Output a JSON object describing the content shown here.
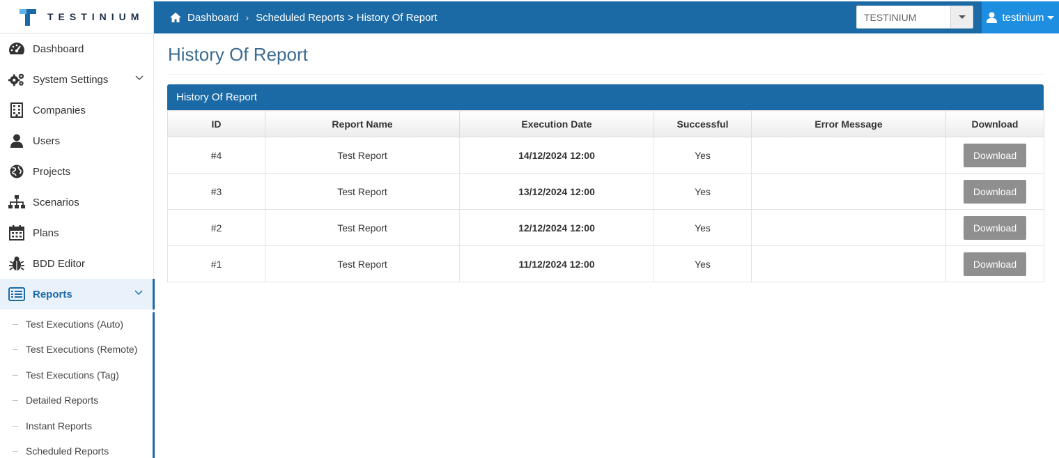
{
  "brand": {
    "name": "TESTINIUM"
  },
  "header": {
    "breadcrumb": {
      "home": "Dashboard",
      "path": "Scheduled Reports > History Of Report"
    },
    "company_select": {
      "value": "TESTINIUM"
    },
    "user": {
      "name": "testinium"
    }
  },
  "sidebar": {
    "items": [
      {
        "label": "Dashboard",
        "icon": "dashboard-gauge-icon"
      },
      {
        "label": "System Settings",
        "icon": "gears-icon"
      },
      {
        "label": "Companies",
        "icon": "building-icon"
      },
      {
        "label": "Users",
        "icon": "user-icon"
      },
      {
        "label": "Projects",
        "icon": "globe-icon"
      },
      {
        "label": "Scenarios",
        "icon": "sitemap-icon"
      },
      {
        "label": "Plans",
        "icon": "calendar-icon"
      },
      {
        "label": "BDD Editor",
        "icon": "bug-icon"
      },
      {
        "label": "Reports",
        "icon": "list-alt-icon"
      }
    ],
    "reports_submenu": [
      "Test Executions (Auto)",
      "Test Executions (Remote)",
      "Test Executions (Tag)",
      "Detailed Reports",
      "Instant Reports",
      "Scheduled Reports"
    ]
  },
  "main": {
    "title": "History Of Report",
    "panel_title": "History Of Report",
    "columns": [
      "ID",
      "Report Name",
      "Execution Date",
      "Successful",
      "Error Message",
      "Download"
    ],
    "rows": [
      {
        "id": "#4",
        "name": "Test Report",
        "date": "14/12/2024 12:00",
        "successful": "Yes",
        "error": "",
        "download": "Download"
      },
      {
        "id": "#3",
        "name": "Test Report",
        "date": "13/12/2024 12:00",
        "successful": "Yes",
        "error": "",
        "download": "Download"
      },
      {
        "id": "#2",
        "name": "Test Report",
        "date": "12/12/2024 12:00",
        "successful": "Yes",
        "error": "",
        "download": "Download"
      },
      {
        "id": "#1",
        "name": "Test Report",
        "date": "11/12/2024 12:00",
        "successful": "Yes",
        "error": "",
        "download": "Download"
      }
    ]
  },
  "colors": {
    "primary": "#1b6aa5",
    "user_menu": "#1e8ee0",
    "button_gray": "#8f8f8f"
  }
}
